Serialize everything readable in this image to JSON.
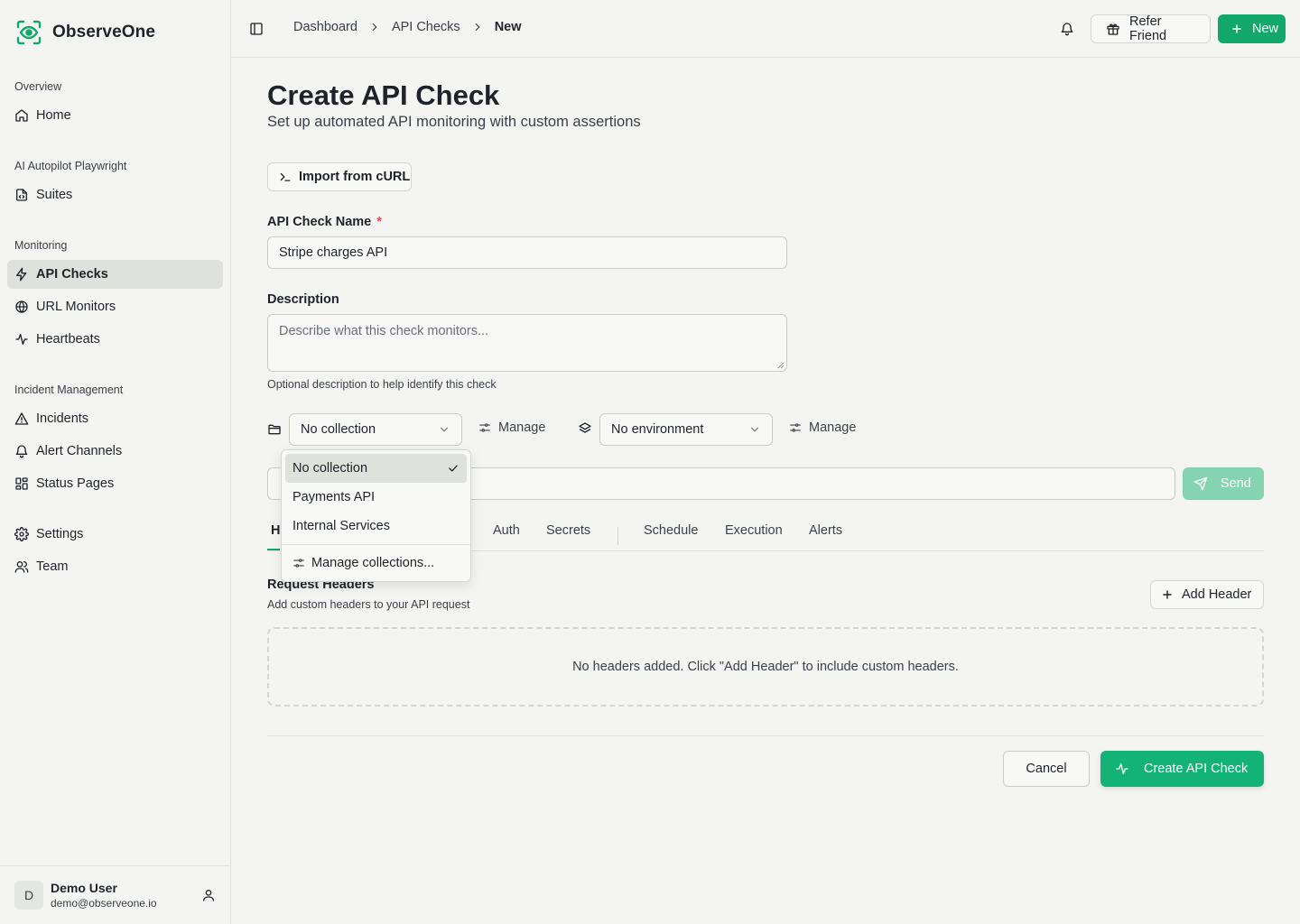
{
  "app": {
    "name": "ObserveOne",
    "accent": "#13a86b"
  },
  "sidebar": {
    "sections": [
      {
        "title": "Overview",
        "items": [
          {
            "label": "Home",
            "icon": "home-icon"
          }
        ]
      },
      {
        "title": "AI Autopilot Playwright",
        "items": [
          {
            "label": "Suites",
            "icon": "suites-icon"
          }
        ]
      },
      {
        "title": "Monitoring",
        "items": [
          {
            "label": "API Checks",
            "icon": "zap-icon",
            "active": true
          },
          {
            "label": "URL Monitors",
            "icon": "globe-icon"
          },
          {
            "label": "Heartbeats",
            "icon": "activity-icon"
          }
        ]
      },
      {
        "title": "Incident Management",
        "items": [
          {
            "label": "Incidents",
            "icon": "alert-triangle-icon"
          },
          {
            "label": "Alert Channels",
            "icon": "bell-icon"
          },
          {
            "label": "Status Pages",
            "icon": "layout-grid-icon"
          }
        ]
      },
      {
        "title": "",
        "items": [
          {
            "label": "Settings",
            "icon": "gear-icon"
          },
          {
            "label": "Team",
            "icon": "users-icon"
          }
        ]
      }
    ],
    "user": {
      "initial": "D",
      "name": "Demo User",
      "email": "demo@observeone.io"
    }
  },
  "header": {
    "breadcrumb": [
      "Dashboard",
      "API Checks",
      "New"
    ],
    "refer_label": "Refer Friend",
    "new_label": "New"
  },
  "page": {
    "title": "Create API Check",
    "subtitle": "Set up automated API monitoring with custom assertions",
    "import_label": "Import from cURL",
    "name_label": "API Check Name",
    "name_required": "*",
    "name_value": "Stripe charges API",
    "description_label": "Description",
    "description_placeholder": "Describe what this check monitors...",
    "description_hint": "Optional description to help identify this check",
    "collection_value": "No collection",
    "environment_value": "No environment",
    "manage_label": "Manage",
    "url_value": "",
    "send_label": "Send",
    "tabs": [
      "H",
      "Auth",
      "Secrets",
      "Schedule",
      "Execution",
      "Alerts"
    ],
    "headers_title": "Request Headers",
    "headers_subtitle": "Add custom headers to your API request",
    "add_header_label": "Add Header",
    "empty_headers": "No headers added. Click \"Add Header\" to include custom headers.",
    "cancel_label": "Cancel",
    "create_label": "Create API Check"
  },
  "collection_dropdown": {
    "options": [
      "No collection",
      "Payments API",
      "Internal Services"
    ],
    "selected": "No collection",
    "manage_label": "Manage collections..."
  }
}
